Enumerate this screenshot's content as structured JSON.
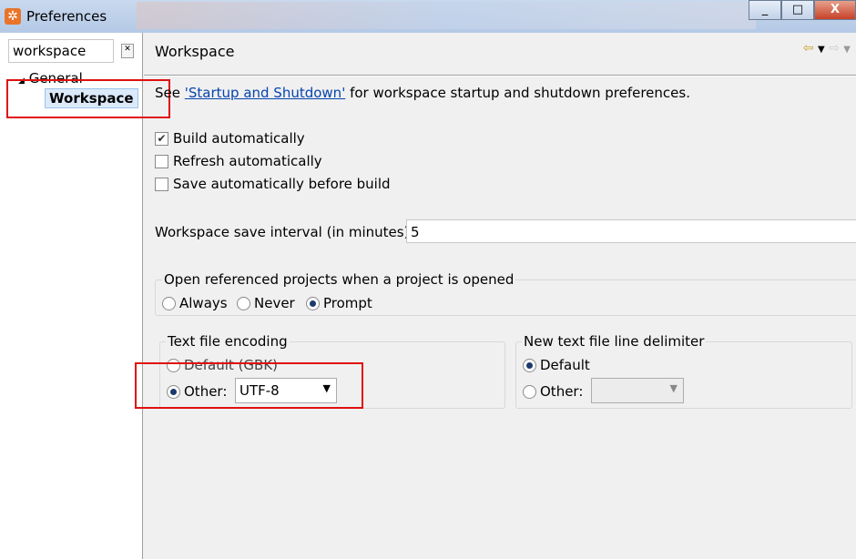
{
  "window": {
    "title": "Preferences",
    "minimize": "_",
    "maximize": "□",
    "close": "X"
  },
  "sidebar": {
    "filter_value": "workspace",
    "tree": {
      "general": "General",
      "workspace": "Workspace"
    }
  },
  "page": {
    "title": "Workspace",
    "see_prefix": "See ",
    "see_link": "'Startup and Shutdown'",
    "see_suffix": " for workspace startup and shutdown preferences.",
    "checkboxes": [
      {
        "label": "Build automatically",
        "checked": true
      },
      {
        "label": "Refresh automatically",
        "checked": false
      },
      {
        "label": "Save automatically before build",
        "checked": false
      }
    ],
    "interval_label": "Workspace save interval (in minutes):",
    "interval_value": "5",
    "open_group": {
      "label": "Open referenced projects when a project is opened",
      "options": [
        "Always",
        "Never",
        "Prompt"
      ],
      "selected": "Prompt"
    },
    "encoding": {
      "label": "Text file encoding",
      "default": "Default (GBK)",
      "other": "Other:",
      "value": "UTF-8",
      "selected": "Other"
    },
    "delimiter": {
      "label": "New text file line delimiter",
      "default": "Default",
      "other": "Other:",
      "value": "",
      "selected": "Default"
    }
  },
  "annotations": {
    "highlight_color": "#e01010"
  }
}
